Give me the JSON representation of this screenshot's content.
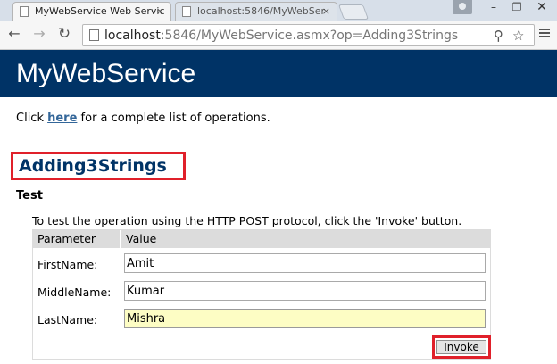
{
  "browser": {
    "tabs": [
      {
        "title": "MyWebService Web Servic",
        "active": true
      },
      {
        "title": "localhost:5846/MyWebSer",
        "active": false
      }
    ],
    "tab_close_glyph": "×",
    "address": {
      "host": "localhost",
      "rest": ":5846/MyWebService.asmx?op=Adding3Strings"
    },
    "icons": [
      "back-icon",
      "forward-icon",
      "reload-icon",
      "page-icon",
      "zoom-icon",
      "star-icon",
      "menu-icon",
      "user-icon",
      "minimize-icon",
      "maximize-icon",
      "close-icon"
    ]
  },
  "page": {
    "service_title": "MyWebService",
    "intro": {
      "before": "Click ",
      "link": "here",
      "after": " for a complete list of operations."
    },
    "operation_title": "Adding3Strings",
    "test_heading": "Test",
    "test_description": "To test the operation using the HTTP POST protocol, click the 'Invoke' button.",
    "table": {
      "headers": {
        "parameter": "Parameter",
        "value": "Value"
      },
      "fields": [
        {
          "label": "FirstName:",
          "value": "Amit"
        },
        {
          "label": "MiddleName:",
          "value": "Kumar"
        },
        {
          "label": "LastName:",
          "value": "Mishra"
        }
      ],
      "invoke_label": "Invoke"
    }
  },
  "colors": {
    "header_band": "#003366",
    "highlight_box": "#e0202a",
    "focused_input": "#fdfdc4"
  }
}
